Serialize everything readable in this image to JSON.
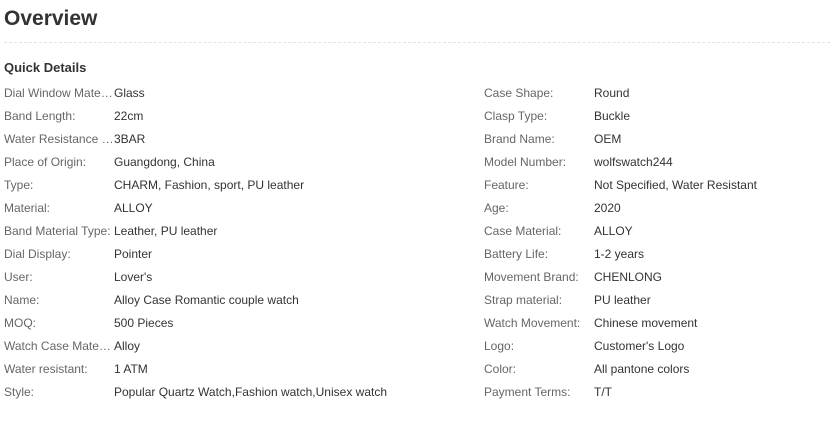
{
  "overview": {
    "title": "Overview",
    "section_title": "Quick Details"
  },
  "details_left": [
    {
      "label": "Dial Window Material Type:",
      "value": "Glass"
    },
    {
      "label": "Band Length:",
      "value": "22cm"
    },
    {
      "label": "Water Resistance Depth:",
      "value": "3BAR"
    },
    {
      "label": "Place of Origin:",
      "value": "Guangdong, China"
    },
    {
      "label": "Type:",
      "value": "CHARM, Fashion, sport, PU leather"
    },
    {
      "label": "Material:",
      "value": "ALLOY"
    },
    {
      "label": "Band Material Type:",
      "value": "Leather, PU leather"
    },
    {
      "label": "Dial Display:",
      "value": "Pointer"
    },
    {
      "label": "User:",
      "value": "Lover's"
    },
    {
      "label": "Name:",
      "value": "Alloy Case Romantic couple watch"
    },
    {
      "label": "MOQ:",
      "value": "500 Pieces"
    },
    {
      "label": "Watch Case Material:",
      "value": "Alloy"
    },
    {
      "label": "Water resistant:",
      "value": "1 ATM"
    },
    {
      "label": "Style:",
      "value": "Popular Quartz Watch,Fashion watch,Unisex watch"
    }
  ],
  "details_right": [
    {
      "label": "Case Shape:",
      "value": "Round"
    },
    {
      "label": "Clasp Type:",
      "value": "Buckle"
    },
    {
      "label": "Brand Name:",
      "value": "OEM"
    },
    {
      "label": "Model Number:",
      "value": "wolfswatch244"
    },
    {
      "label": "Feature:",
      "value": "Not Specified, Water Resistant"
    },
    {
      "label": "Age:",
      "value": "2020"
    },
    {
      "label": "Case Material:",
      "value": "ALLOY"
    },
    {
      "label": "Battery Life:",
      "value": "1-2 years"
    },
    {
      "label": "Movement Brand:",
      "value": "CHENLONG"
    },
    {
      "label": "Strap material:",
      "value": "PU leather"
    },
    {
      "label": "Watch Movement:",
      "value": "Chinese movement"
    },
    {
      "label": "Logo:",
      "value": "Customer's Logo"
    },
    {
      "label": "Color:",
      "value": "All pantone colors"
    },
    {
      "label": "Payment Terms:",
      "value": "T/T"
    }
  ]
}
